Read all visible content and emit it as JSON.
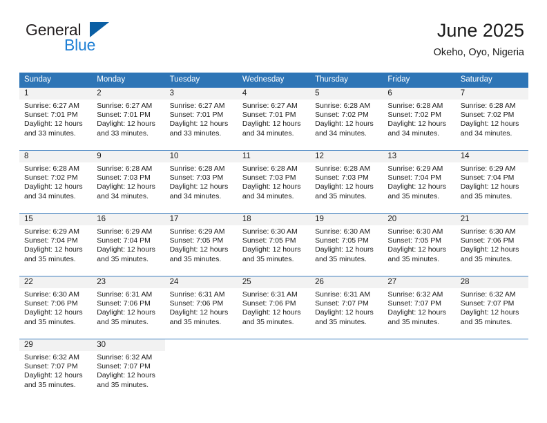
{
  "brand": {
    "word1": "General",
    "word2": "Blue",
    "triangle_color": "#0b5fa4",
    "blue_color": "#1e7fd4"
  },
  "header": {
    "title": "June 2025",
    "location": "Okeho, Oyo, Nigeria"
  },
  "theme": {
    "header_bg": "#2e75b6",
    "daynum_bg": "#f2f2f2",
    "row_border": "#3a7cbe",
    "text": "#1a1a1a"
  },
  "weekday_headers": [
    "Sunday",
    "Monday",
    "Tuesday",
    "Wednesday",
    "Thursday",
    "Friday",
    "Saturday"
  ],
  "weeks": [
    [
      {
        "day": "1",
        "sunrise": "Sunrise: 6:27 AM",
        "sunset": "Sunset: 7:01 PM",
        "daylight1": "Daylight: 12 hours",
        "daylight2": "and 33 minutes."
      },
      {
        "day": "2",
        "sunrise": "Sunrise: 6:27 AM",
        "sunset": "Sunset: 7:01 PM",
        "daylight1": "Daylight: 12 hours",
        "daylight2": "and 33 minutes."
      },
      {
        "day": "3",
        "sunrise": "Sunrise: 6:27 AM",
        "sunset": "Sunset: 7:01 PM",
        "daylight1": "Daylight: 12 hours",
        "daylight2": "and 33 minutes."
      },
      {
        "day": "4",
        "sunrise": "Sunrise: 6:27 AM",
        "sunset": "Sunset: 7:01 PM",
        "daylight1": "Daylight: 12 hours",
        "daylight2": "and 34 minutes."
      },
      {
        "day": "5",
        "sunrise": "Sunrise: 6:28 AM",
        "sunset": "Sunset: 7:02 PM",
        "daylight1": "Daylight: 12 hours",
        "daylight2": "and 34 minutes."
      },
      {
        "day": "6",
        "sunrise": "Sunrise: 6:28 AM",
        "sunset": "Sunset: 7:02 PM",
        "daylight1": "Daylight: 12 hours",
        "daylight2": "and 34 minutes."
      },
      {
        "day": "7",
        "sunrise": "Sunrise: 6:28 AM",
        "sunset": "Sunset: 7:02 PM",
        "daylight1": "Daylight: 12 hours",
        "daylight2": "and 34 minutes."
      }
    ],
    [
      {
        "day": "8",
        "sunrise": "Sunrise: 6:28 AM",
        "sunset": "Sunset: 7:02 PM",
        "daylight1": "Daylight: 12 hours",
        "daylight2": "and 34 minutes."
      },
      {
        "day": "9",
        "sunrise": "Sunrise: 6:28 AM",
        "sunset": "Sunset: 7:03 PM",
        "daylight1": "Daylight: 12 hours",
        "daylight2": "and 34 minutes."
      },
      {
        "day": "10",
        "sunrise": "Sunrise: 6:28 AM",
        "sunset": "Sunset: 7:03 PM",
        "daylight1": "Daylight: 12 hours",
        "daylight2": "and 34 minutes."
      },
      {
        "day": "11",
        "sunrise": "Sunrise: 6:28 AM",
        "sunset": "Sunset: 7:03 PM",
        "daylight1": "Daylight: 12 hours",
        "daylight2": "and 34 minutes."
      },
      {
        "day": "12",
        "sunrise": "Sunrise: 6:28 AM",
        "sunset": "Sunset: 7:03 PM",
        "daylight1": "Daylight: 12 hours",
        "daylight2": "and 35 minutes."
      },
      {
        "day": "13",
        "sunrise": "Sunrise: 6:29 AM",
        "sunset": "Sunset: 7:04 PM",
        "daylight1": "Daylight: 12 hours",
        "daylight2": "and 35 minutes."
      },
      {
        "day": "14",
        "sunrise": "Sunrise: 6:29 AM",
        "sunset": "Sunset: 7:04 PM",
        "daylight1": "Daylight: 12 hours",
        "daylight2": "and 35 minutes."
      }
    ],
    [
      {
        "day": "15",
        "sunrise": "Sunrise: 6:29 AM",
        "sunset": "Sunset: 7:04 PM",
        "daylight1": "Daylight: 12 hours",
        "daylight2": "and 35 minutes."
      },
      {
        "day": "16",
        "sunrise": "Sunrise: 6:29 AM",
        "sunset": "Sunset: 7:04 PM",
        "daylight1": "Daylight: 12 hours",
        "daylight2": "and 35 minutes."
      },
      {
        "day": "17",
        "sunrise": "Sunrise: 6:29 AM",
        "sunset": "Sunset: 7:05 PM",
        "daylight1": "Daylight: 12 hours",
        "daylight2": "and 35 minutes."
      },
      {
        "day": "18",
        "sunrise": "Sunrise: 6:30 AM",
        "sunset": "Sunset: 7:05 PM",
        "daylight1": "Daylight: 12 hours",
        "daylight2": "and 35 minutes."
      },
      {
        "day": "19",
        "sunrise": "Sunrise: 6:30 AM",
        "sunset": "Sunset: 7:05 PM",
        "daylight1": "Daylight: 12 hours",
        "daylight2": "and 35 minutes."
      },
      {
        "day": "20",
        "sunrise": "Sunrise: 6:30 AM",
        "sunset": "Sunset: 7:05 PM",
        "daylight1": "Daylight: 12 hours",
        "daylight2": "and 35 minutes."
      },
      {
        "day": "21",
        "sunrise": "Sunrise: 6:30 AM",
        "sunset": "Sunset: 7:06 PM",
        "daylight1": "Daylight: 12 hours",
        "daylight2": "and 35 minutes."
      }
    ],
    [
      {
        "day": "22",
        "sunrise": "Sunrise: 6:30 AM",
        "sunset": "Sunset: 7:06 PM",
        "daylight1": "Daylight: 12 hours",
        "daylight2": "and 35 minutes."
      },
      {
        "day": "23",
        "sunrise": "Sunrise: 6:31 AM",
        "sunset": "Sunset: 7:06 PM",
        "daylight1": "Daylight: 12 hours",
        "daylight2": "and 35 minutes."
      },
      {
        "day": "24",
        "sunrise": "Sunrise: 6:31 AM",
        "sunset": "Sunset: 7:06 PM",
        "daylight1": "Daylight: 12 hours",
        "daylight2": "and 35 minutes."
      },
      {
        "day": "25",
        "sunrise": "Sunrise: 6:31 AM",
        "sunset": "Sunset: 7:06 PM",
        "daylight1": "Daylight: 12 hours",
        "daylight2": "and 35 minutes."
      },
      {
        "day": "26",
        "sunrise": "Sunrise: 6:31 AM",
        "sunset": "Sunset: 7:07 PM",
        "daylight1": "Daylight: 12 hours",
        "daylight2": "and 35 minutes."
      },
      {
        "day": "27",
        "sunrise": "Sunrise: 6:32 AM",
        "sunset": "Sunset: 7:07 PM",
        "daylight1": "Daylight: 12 hours",
        "daylight2": "and 35 minutes."
      },
      {
        "day": "28",
        "sunrise": "Sunrise: 6:32 AM",
        "sunset": "Sunset: 7:07 PM",
        "daylight1": "Daylight: 12 hours",
        "daylight2": "and 35 minutes."
      }
    ],
    [
      {
        "day": "29",
        "sunrise": "Sunrise: 6:32 AM",
        "sunset": "Sunset: 7:07 PM",
        "daylight1": "Daylight: 12 hours",
        "daylight2": "and 35 minutes."
      },
      {
        "day": "30",
        "sunrise": "Sunrise: 6:32 AM",
        "sunset": "Sunset: 7:07 PM",
        "daylight1": "Daylight: 12 hours",
        "daylight2": "and 35 minutes."
      },
      {
        "day": "",
        "sunrise": "",
        "sunset": "",
        "daylight1": "",
        "daylight2": ""
      },
      {
        "day": "",
        "sunrise": "",
        "sunset": "",
        "daylight1": "",
        "daylight2": ""
      },
      {
        "day": "",
        "sunrise": "",
        "sunset": "",
        "daylight1": "",
        "daylight2": ""
      },
      {
        "day": "",
        "sunrise": "",
        "sunset": "",
        "daylight1": "",
        "daylight2": ""
      },
      {
        "day": "",
        "sunrise": "",
        "sunset": "",
        "daylight1": "",
        "daylight2": ""
      }
    ]
  ]
}
